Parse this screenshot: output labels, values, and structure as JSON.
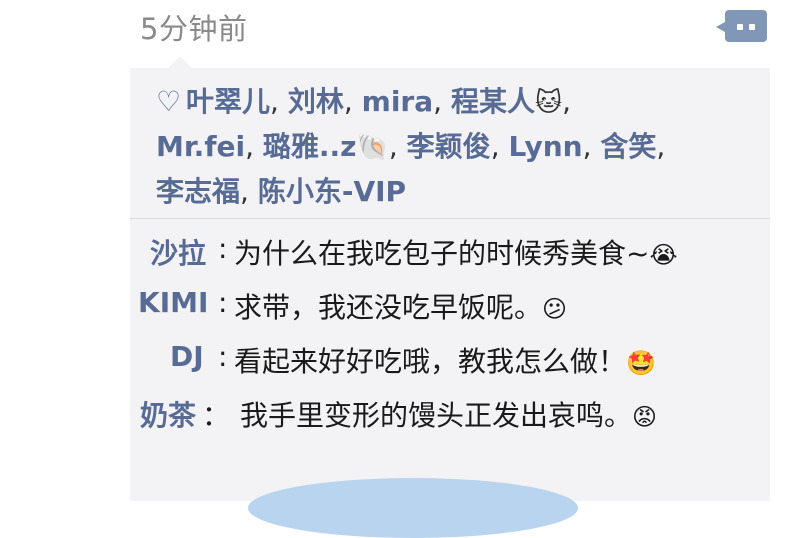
{
  "header": {
    "time": "5分钟前"
  },
  "likes": {
    "names": [
      {
        "name": "叶翠儿"
      },
      {
        "name": "刘林"
      },
      {
        "name": "mira"
      },
      {
        "name": "程某人",
        "emoji": "🐱"
      },
      {
        "name": "Mr.fei"
      },
      {
        "name": "璐雅..z",
        "emoji": "🐚"
      },
      {
        "name": "李颖俊"
      },
      {
        "name": "Lynn"
      },
      {
        "name": "含笑"
      },
      {
        "name": "李志福"
      },
      {
        "name": "陈小东-VIP"
      }
    ],
    "separator": ", ",
    "trail": ","
  },
  "comments": [
    {
      "author": "沙拉",
      "colon": ":",
      "text": "为什么在我吃包子的时候秀美食~",
      "emoji": "😭"
    },
    {
      "author": "KIMI",
      "colon": ":",
      "text": "求带，我还没吃早饭呢。",
      "emoji": "😕"
    },
    {
      "author": "DJ",
      "colon": ":",
      "text": "看起来好好吃哦，教我怎么做！",
      "emoji": "🤩"
    },
    {
      "author": "奶茶",
      "colon": "：",
      "text": "我手里变形的馒头正发出哀鸣。",
      "emoji": "😡"
    }
  ],
  "icons": {
    "like": "heart-icon",
    "comment": "comment-icon"
  },
  "colors": {
    "link": "#576b95",
    "panel": "#f3f3f5",
    "comment_button": "#8097b7"
  }
}
